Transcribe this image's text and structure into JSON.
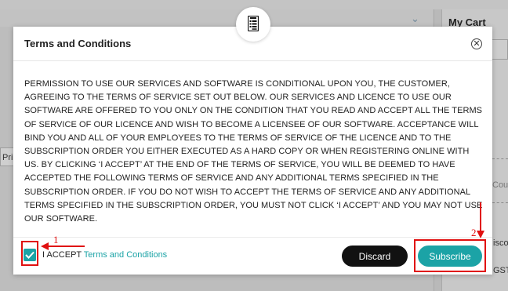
{
  "background": {
    "left_tab_label": "Pri",
    "cart_title": "My Cart",
    "cart_tab_label": "n",
    "field_hint": "Cou",
    "item_text": "isco",
    "tax_text": "GST"
  },
  "modal": {
    "badge_icon": "document-list-icon",
    "title": "Terms and Conditions",
    "close_icon": "close-circle-icon",
    "body": "PERMISSION TO USE OUR SERVICES AND SOFTWARE IS CONDITIONAL UPON YOU, THE CUSTOMER, AGREEING TO THE TERMS OF SERVICE SET OUT BELOW. OUR SERVICES AND LICENCE TO USE OUR SOFTWARE ARE OFFERED TO YOU ONLY ON THE CONDITION THAT YOU READ AND ACCEPT ALL THE TERMS OF SERVICE OF OUR LICENCE AND WISH TO BECOME A LICENSEE OF OUR SOFTWARE. ACCEPTANCE WILL BIND YOU AND ALL OF YOUR EMPLOYEES TO THE TERMS OF SERVICE OF THE LICENCE AND TO THE SUBSCRIPTION ORDER YOU EITHER EXECUTED AS A HARD COPY OR WHEN REGISTERING ONLINE WITH US. BY CLICKING ‘I ACCEPT’ AT THE END OF THE TERMS OF SERVICE, YOU WILL BE DEEMED TO HAVE ACCEPTED THE FOLLOWING TERMS OF SERVICE AND ANY ADDITIONAL TERMS SPECIFIED IN THE SUBSCRIPTION ORDER. IF YOU DO NOT WISH TO ACCEPT THE TERMS OF SERVICE AND ANY ADDITIONAL TERMS SPECIFIED IN THE SUBSCRIPTION ORDER, YOU MUST NOT CLICK ‘I ACCEPT’ AND YOU MAY NOT USE OUR SOFTWARE.",
    "accept_prefix": "I ACCEPT",
    "accept_link": "Terms and Conditions",
    "accept_checked": true,
    "discard_label": "Discard",
    "subscribe_label": "Subscribe"
  },
  "annotations": {
    "step1": "1",
    "step2": "2",
    "color": "#e01010"
  },
  "colors": {
    "accent": "#1ba3a6",
    "discard_bg": "#111111"
  }
}
